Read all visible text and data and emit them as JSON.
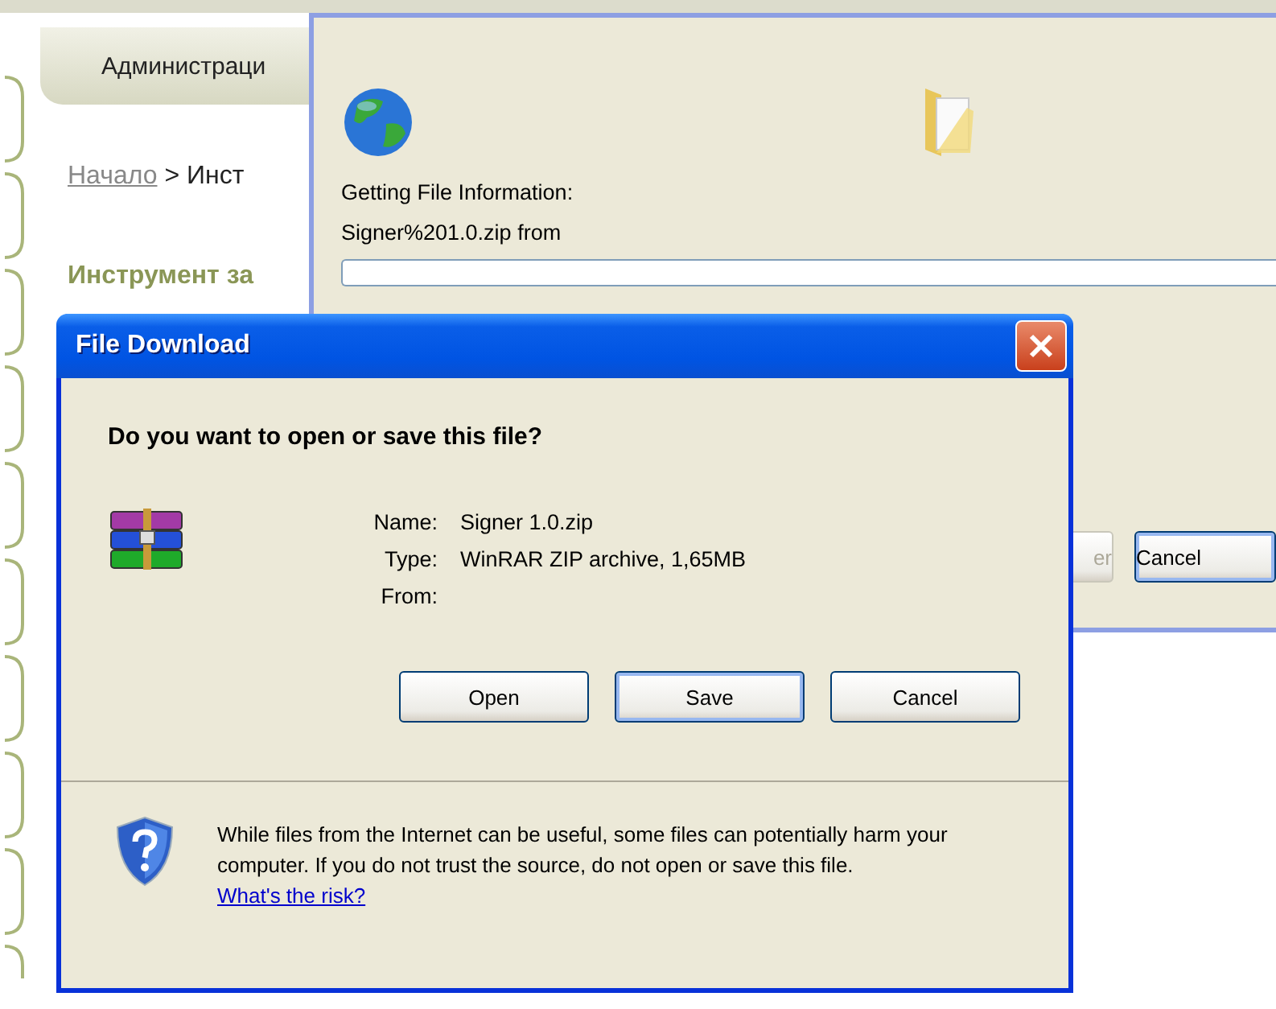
{
  "page": {
    "tab": "Администраци",
    "breadcrumb": {
      "link": "Начало",
      "separator": ">",
      "current": "Инст"
    },
    "heading": "Инструмент за"
  },
  "progress_window": {
    "status": "Getting File Information:",
    "file": "Signer%201.0.zip from",
    "progress": {
      "level": 0
    },
    "buttons": [
      {
        "label": "er",
        "disabled": true,
        "focused": false
      },
      {
        "label": "Cancel",
        "disabled": false,
        "focused": true
      }
    ]
  },
  "dialog": {
    "title": "File Download",
    "question": "Do you want to open or save this file?",
    "fields": [
      {
        "label": "Name:",
        "value": "Signer 1.0.zip"
      },
      {
        "label": "Type:",
        "value": "WinRAR ZIP archive, 1,65MB"
      },
      {
        "label": "From:"
      }
    ],
    "buttons": [
      {
        "label": "Open",
        "focused": false
      },
      {
        "label": "Save",
        "focused": true
      },
      {
        "label": "Cancel",
        "focused": false
      }
    ],
    "warning": "While files from the Internet can be useful, some files can potentially harm your computer. If you do not trust the source, do not open or save this file.",
    "risk_link": "What's the risk?"
  }
}
